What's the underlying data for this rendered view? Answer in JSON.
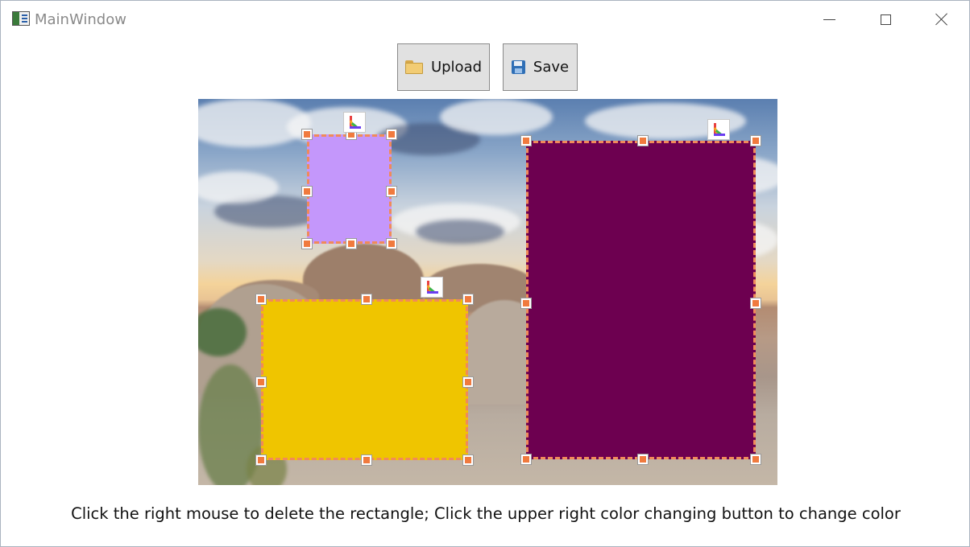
{
  "window": {
    "title": "MainWindow"
  },
  "toolbar": {
    "upload_label": "Upload",
    "save_label": "Save"
  },
  "rectangles": [
    {
      "name": "lavender",
      "fill": "#c497fb"
    },
    {
      "name": "gold",
      "fill": "#efc500"
    },
    {
      "name": "plum",
      "fill": "#6d0050"
    }
  ],
  "colors": {
    "dashed_border": "#f08a5a",
    "handle": "#f07a3e"
  },
  "instructions": "Click the right mouse to delete the rectangle; Click the upper right color changing button to change color"
}
